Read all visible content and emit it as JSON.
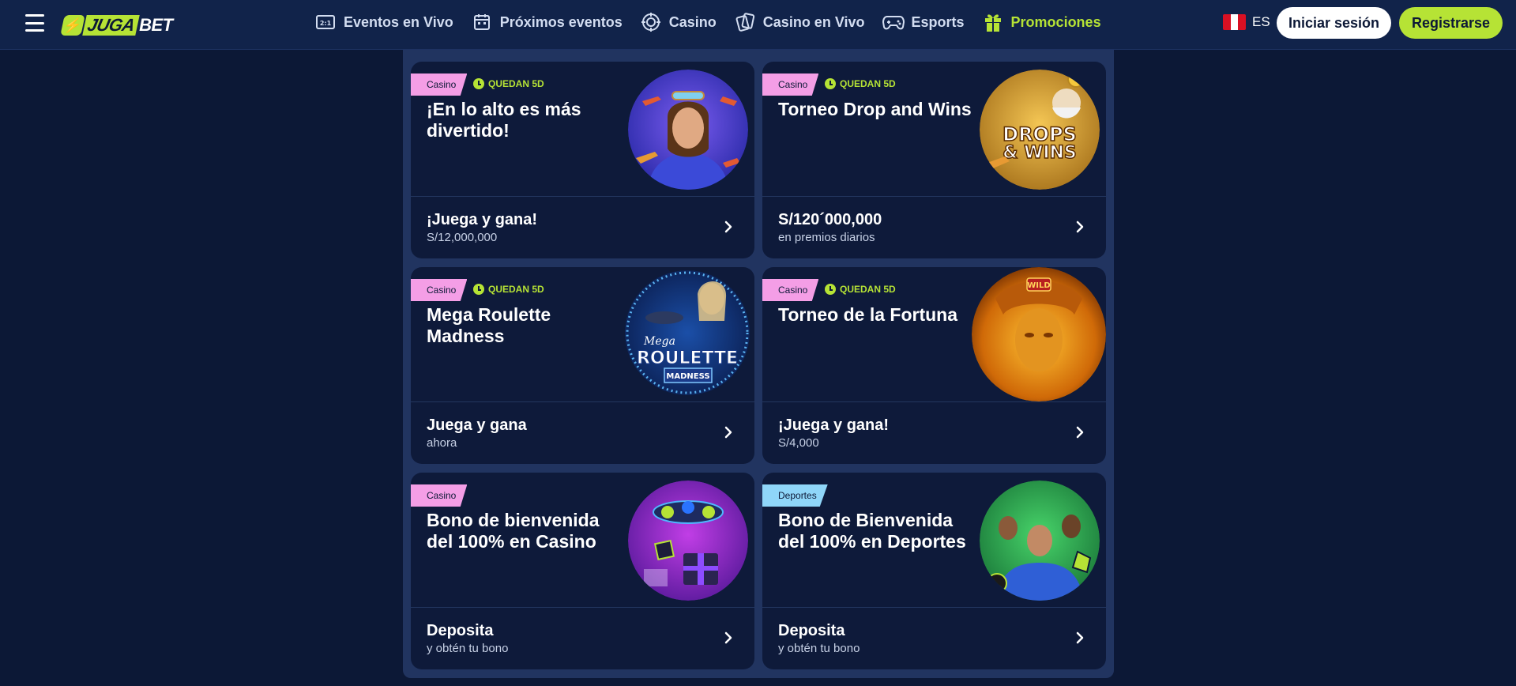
{
  "header": {
    "logo": {
      "part1": "JUGA",
      "part2": "BET"
    },
    "nav": [
      {
        "label": "Eventos en Vivo",
        "icon": "live-scoreboard-icon"
      },
      {
        "label": "Próximos eventos",
        "icon": "calendar-icon"
      },
      {
        "label": "Casino",
        "icon": "casino-chip-icon"
      },
      {
        "label": "Casino en Vivo",
        "icon": "cards-icon"
      },
      {
        "label": "Esports",
        "icon": "gamepad-icon"
      },
      {
        "label": "Promociones",
        "icon": "gift-icon"
      }
    ],
    "language": "ES",
    "login_label": "Iniciar sesión",
    "register_label": "Registrarse"
  },
  "colors": {
    "accent": "#b6e335",
    "background": "#0c1836",
    "header": "#11234a",
    "card": "#0e1a3a",
    "tag_casino": "#f49ee6",
    "tag_deportes": "#8fd6f9"
  },
  "promotions": [
    {
      "tag": "Casino",
      "timer": "QUEDAN 5D",
      "title": "¡En lo alto es más divertido!",
      "bottom_title": "¡Juega y gana!",
      "bottom_sub": "S/12,000,000"
    },
    {
      "tag": "Casino",
      "timer": "QUEDAN 5D",
      "title": "Torneo Drop and Wins",
      "art_text": [
        "DROPS",
        "& WINS"
      ],
      "bottom_title": "S/120´000,000",
      "bottom_sub": "en premios diarios"
    },
    {
      "tag": "Casino",
      "timer": "QUEDAN 5D",
      "title": "Mega Roulette Madness",
      "art_text": [
        "Mega",
        "ROULETTE",
        "MADNESS"
      ],
      "bottom_title": "Juega y gana",
      "bottom_sub": "ahora"
    },
    {
      "tag": "Casino",
      "timer": "QUEDAN 5D",
      "title": "Torneo de la Fortuna",
      "art_text": [
        "WILD"
      ],
      "bottom_title": "¡Juega y gana!",
      "bottom_sub": "S/4,000"
    },
    {
      "tag": "Casino",
      "title": "Bono de bienvenida del 100% en Casino",
      "bottom_title": "Deposita",
      "bottom_sub": "y obtén tu bono"
    },
    {
      "tag": "Deportes",
      "title": "Bono de Bienvenida del 100% en Deportes",
      "bottom_title": "Deposita",
      "bottom_sub": "y obtén tu bono"
    }
  ]
}
